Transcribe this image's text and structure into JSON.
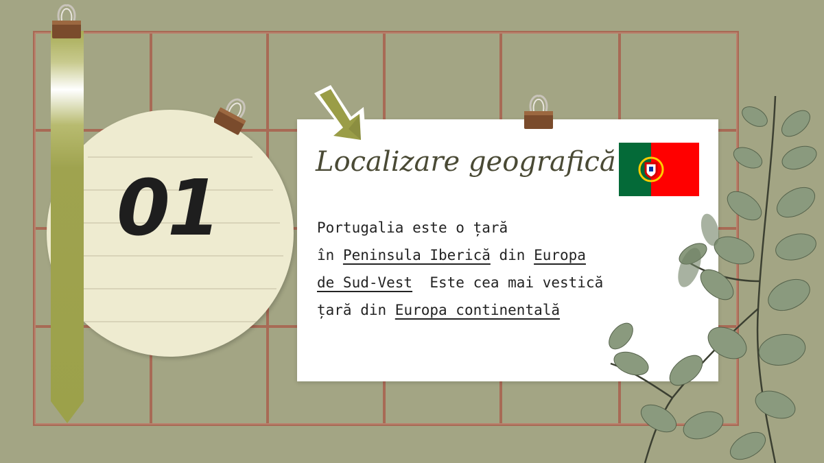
{
  "slide": {
    "number": "01",
    "title": "Localizare geografică",
    "body": {
      "line1": "Portugalia este o țară",
      "line2_pre": "în ",
      "line2_link1": "Peninsula Iberică",
      "line2_mid": " din ",
      "line2_link2": "Europa",
      "line3_link": "de Sud-Vest",
      "line3_post": "  Este cea mai vestică",
      "line4_pre": "țară din ",
      "line4_link": "Europa continentală"
    }
  },
  "colors": {
    "background": "#a3a584",
    "grid": "#a86a55",
    "ribbon": "#9fa34f",
    "circle": "#eeebd0",
    "card": "#ffffff",
    "arrow": "#9a9d47",
    "flag_green": "#046a38",
    "flag_red": "#ff0000"
  },
  "icons": {
    "clip": "binder-clip-icon",
    "arrow": "down-right-arrow-icon",
    "flag": "portugal-flag-icon",
    "decor": "eucalyptus-leaves"
  }
}
